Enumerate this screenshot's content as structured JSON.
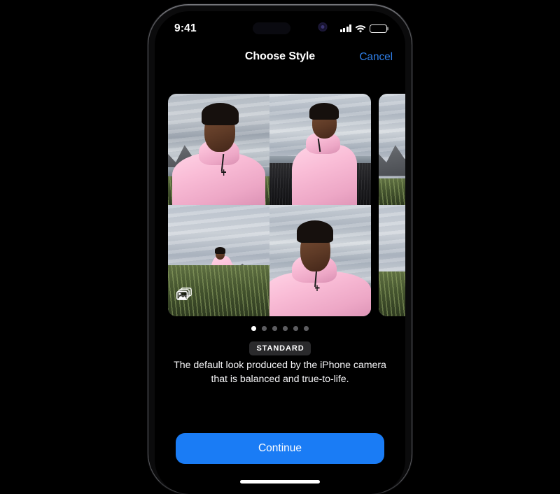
{
  "status_bar": {
    "time": "9:41",
    "signal_icon": "cellular-signal-icon",
    "wifi_icon": "wifi-icon",
    "battery_icon": "battery-icon",
    "battery_level_percent": 100,
    "dynamic_island": "dynamic-island",
    "camera_indicator": "camera-in-use-indicator"
  },
  "nav_bar": {
    "title": "Choose Style",
    "cancel_label": "Cancel",
    "accent_color": "#2f7fe8"
  },
  "carousel": {
    "current_index": 0,
    "total": 6,
    "dots": [
      {
        "active": true
      },
      {
        "active": false
      },
      {
        "active": false
      },
      {
        "active": false
      },
      {
        "active": false
      },
      {
        "active": false
      }
    ],
    "photo_stack_icon": "photo-stack-icon",
    "photos": [
      {
        "alt": "selfie portrait in pink coat with mountains"
      },
      {
        "alt": "person in pink coat on black sand beach"
      },
      {
        "alt": "wide shot of person in pink coat in tall grass"
      },
      {
        "alt": "close portrait in pink coat against cloudy sky"
      }
    ]
  },
  "style": {
    "name": "STANDARD",
    "description": "The default look produced by the iPhone camera that is balanced and true-to-life."
  },
  "footer": {
    "continue_label": "Continue",
    "continue_color": "#1a7cf5",
    "home_indicator": "home-indicator"
  }
}
